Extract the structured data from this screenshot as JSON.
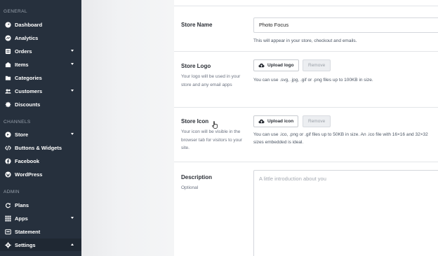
{
  "sidebar": {
    "sections": [
      {
        "title": "GENERAL",
        "items": [
          {
            "label": "Dashboard",
            "icon": "dashboard-icon"
          },
          {
            "label": "Analytics",
            "icon": "analytics-icon"
          },
          {
            "label": "Orders",
            "icon": "orders-icon",
            "expandable": true
          },
          {
            "label": "Items",
            "icon": "items-icon",
            "expandable": true
          },
          {
            "label": "Categories",
            "icon": "folder-icon"
          },
          {
            "label": "Customers",
            "icon": "users-icon",
            "expandable": true
          },
          {
            "label": "Discounts",
            "icon": "discount-icon"
          }
        ]
      },
      {
        "title": "CHANNELS",
        "items": [
          {
            "label": "Store",
            "icon": "store-icon",
            "expandable": true
          },
          {
            "label": "Buttons & Widgets",
            "icon": "code-icon"
          },
          {
            "label": "Facebook",
            "icon": "facebook-icon"
          },
          {
            "label": "WordPress",
            "icon": "wordpress-icon"
          }
        ]
      },
      {
        "title": "ADMIN",
        "items": [
          {
            "label": "Plans",
            "icon": "refresh-icon"
          },
          {
            "label": "Apps",
            "icon": "apps-grid-icon",
            "expandable": true
          },
          {
            "label": "Statement",
            "icon": "statement-icon"
          },
          {
            "label": "Settings",
            "icon": "gear-icon",
            "expandable": true,
            "active": true
          }
        ]
      }
    ]
  },
  "form": {
    "store_name": {
      "label": "Store Name",
      "value": "Photo Focus",
      "help": "This will appear in your store, checkout and emails."
    },
    "store_logo": {
      "label": "Store Logo",
      "description": "Your logo will be used in your store and any email apps",
      "upload_label": "Upload logo",
      "remove_label": "Remove",
      "help": "You can use .svg, .jpg, .gif or .png files up to 100KB in size."
    },
    "store_icon": {
      "label": "Store Icon",
      "description": "Your icon will be visible in the browser tab for visitors to your site.",
      "upload_label": "Upload icon",
      "remove_label": "Remove",
      "help": "You can use .ico, .png or .gif files up to 50KB in size. An .ico file with 16×16 and 32×32 sizes embedded is ideal."
    },
    "description": {
      "label": "Description",
      "sublabel": "Optional",
      "placeholder": "A little introduction about you"
    }
  },
  "colors": {
    "sidebar_bg": "#26303d",
    "accent": "#ffffff"
  }
}
